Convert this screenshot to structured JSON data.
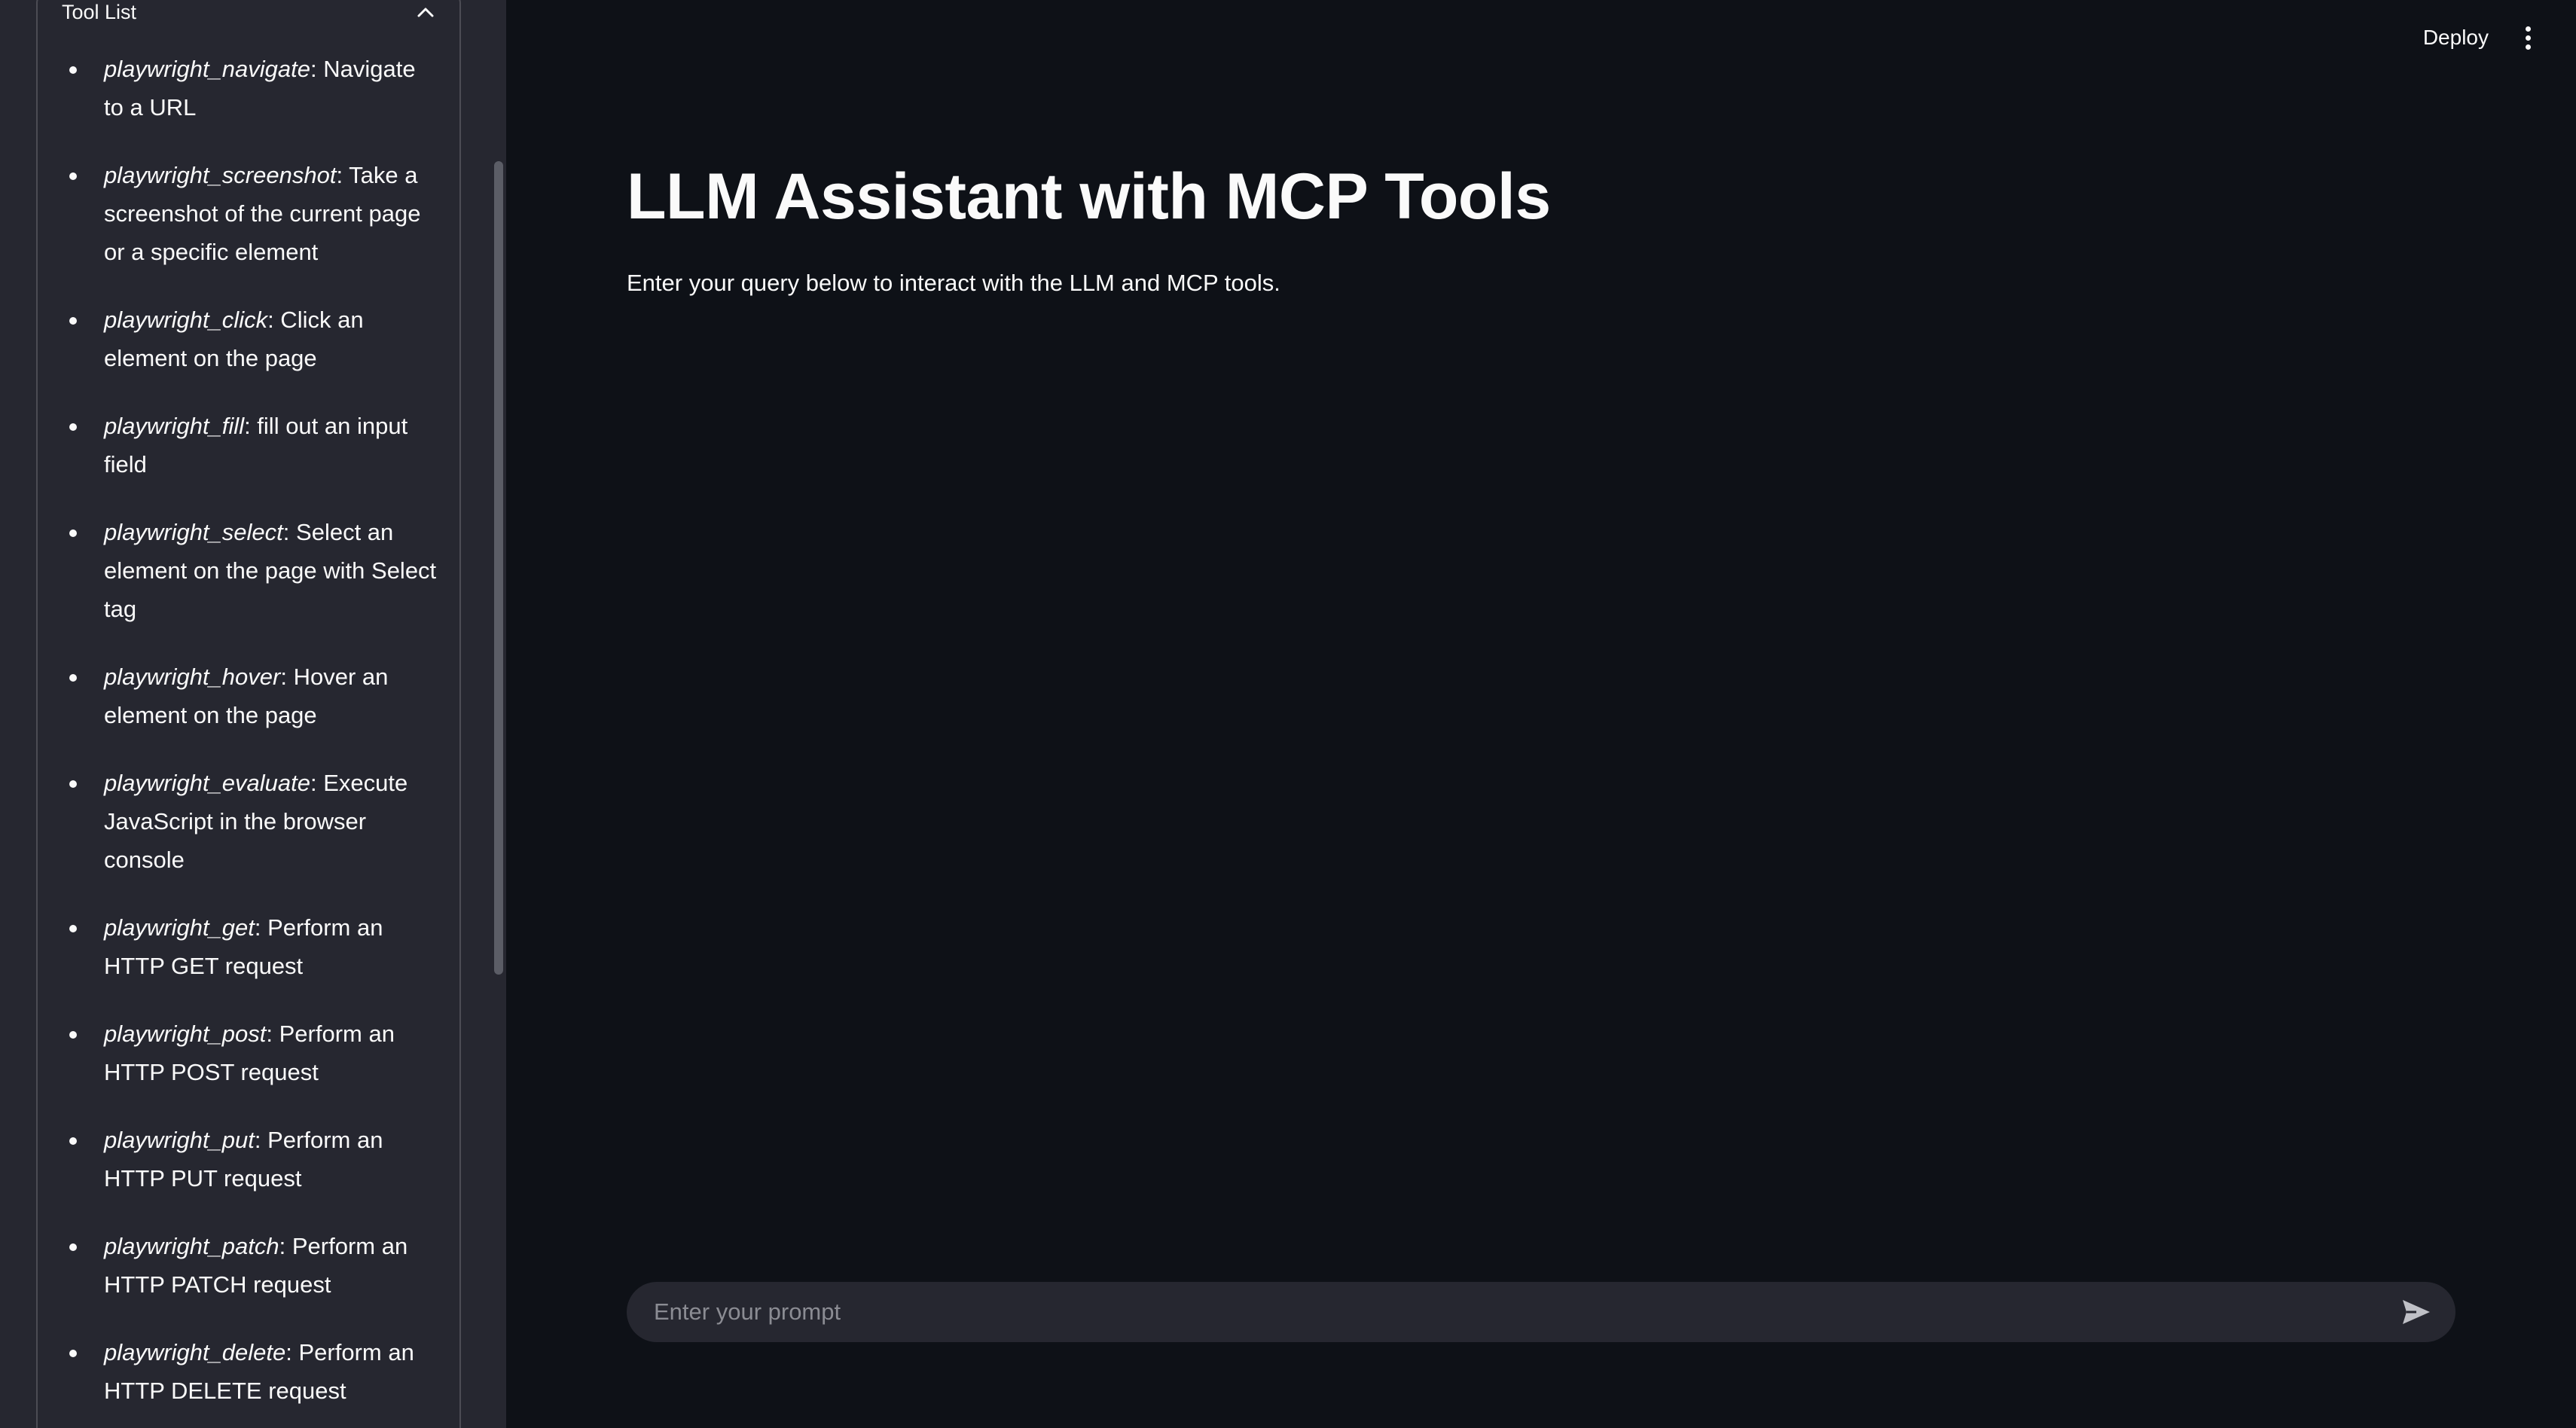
{
  "sidebar": {
    "expander_title": "Tool List",
    "tools": [
      {
        "name": "playwright_navigate",
        "desc": ": Navigate to a URL"
      },
      {
        "name": "playwright_screenshot",
        "desc": ": Take a screenshot of the current page or a specific element"
      },
      {
        "name": "playwright_click",
        "desc": ": Click an element on the page"
      },
      {
        "name": "playwright_fill",
        "desc": ": fill out an input field"
      },
      {
        "name": "playwright_select",
        "desc": ": Select an element on the page with Select tag"
      },
      {
        "name": "playwright_hover",
        "desc": ": Hover an element on the page"
      },
      {
        "name": "playwright_evaluate",
        "desc": ": Execute JavaScript in the browser console"
      },
      {
        "name": "playwright_get",
        "desc": ": Perform an HTTP GET request"
      },
      {
        "name": "playwright_post",
        "desc": ": Perform an HTTP POST request"
      },
      {
        "name": "playwright_put",
        "desc": ": Perform an HTTP PUT request"
      },
      {
        "name": "playwright_patch",
        "desc": ": Perform an HTTP PATCH request"
      },
      {
        "name": "playwright_delete",
        "desc": ": Perform an HTTP DELETE request"
      }
    ]
  },
  "header": {
    "deploy_label": "Deploy"
  },
  "main": {
    "title": "LLM Assistant with MCP Tools",
    "subtitle": "Enter your query below to interact with the LLM and MCP tools.",
    "chat_placeholder": "Enter your prompt"
  },
  "icons": {
    "expander": "chevron-up-icon",
    "menu": "vertical-dots-icon",
    "send": "send-arrow-icon"
  },
  "colors": {
    "background": "#0e1117",
    "sidebar": "#262730",
    "text": "#fafafa",
    "placeholder": "#8b8c93"
  }
}
